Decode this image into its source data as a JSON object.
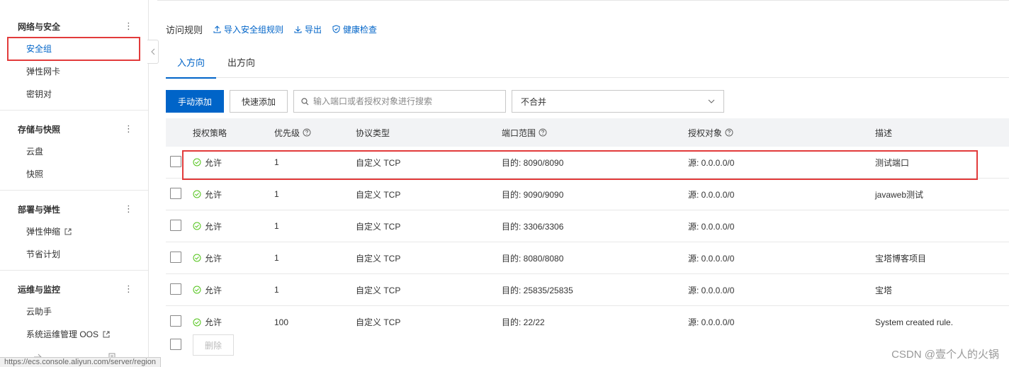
{
  "sidebar": {
    "groups": [
      {
        "title": "网络与安全",
        "items": [
          {
            "label": "安全组"
          },
          {
            "label": "弹性网卡"
          },
          {
            "label": "密钥对"
          }
        ]
      },
      {
        "title": "存储与快照",
        "items": [
          {
            "label": "云盘"
          },
          {
            "label": "快照"
          }
        ]
      },
      {
        "title": "部署与弹性",
        "items": [
          {
            "label": "弹性伸缩"
          },
          {
            "label": "节省计划"
          }
        ]
      },
      {
        "title": "运维与监控",
        "items": [
          {
            "label": "云助手"
          },
          {
            "label": "系统运维管理 OOS"
          }
        ]
      }
    ],
    "active_item": "安全组",
    "more_glyph": "⋮"
  },
  "status_url": "https://ecs.console.aliyun.com/server/region",
  "toolbar": {
    "title": "访问规则",
    "import_label": "导入安全组规则",
    "export_label": "导出",
    "health_label": "健康检查"
  },
  "tabs": [
    {
      "label": "入方向"
    },
    {
      "label": "出方向"
    }
  ],
  "actions": {
    "manual_add": "手动添加",
    "quick_add": "快速添加",
    "search_placeholder": "输入端口或者授权对象进行搜索",
    "merge_select": "不合并"
  },
  "table": {
    "headers": {
      "policy": "授权策略",
      "priority": "优先级",
      "protocol": "协议类型",
      "port": "端口范围",
      "auth": "授权对象",
      "desc": "描述"
    },
    "rows": [
      {
        "policy": "允许",
        "priority": "1",
        "protocol": "自定义 TCP",
        "port": "目的: 8090/8090",
        "auth": "源: 0.0.0.0/0",
        "desc": "测试端口"
      },
      {
        "policy": "允许",
        "priority": "1",
        "protocol": "自定义 TCP",
        "port": "目的: 9090/9090",
        "auth": "源: 0.0.0.0/0",
        "desc": "javaweb测试"
      },
      {
        "policy": "允许",
        "priority": "1",
        "protocol": "自定义 TCP",
        "port": "目的: 3306/3306",
        "auth": "源: 0.0.0.0/0",
        "desc": ""
      },
      {
        "policy": "允许",
        "priority": "1",
        "protocol": "自定义 TCP",
        "port": "目的: 8080/8080",
        "auth": "源: 0.0.0.0/0",
        "desc": "宝塔博客项目"
      },
      {
        "policy": "允许",
        "priority": "1",
        "protocol": "自定义 TCP",
        "port": "目的: 25835/25835",
        "auth": "源: 0.0.0.0/0",
        "desc": "宝塔"
      },
      {
        "policy": "允许",
        "priority": "100",
        "protocol": "自定义 TCP",
        "port": "目的: 22/22",
        "auth": "源: 0.0.0.0/0",
        "desc": "System created rule."
      }
    ],
    "delete_label": "删除"
  },
  "watermark": "CSDN @壹个人的火锅",
  "colors": {
    "accent": "#0064c8",
    "highlight": "#e23b3b",
    "allow": "#52c41a"
  }
}
